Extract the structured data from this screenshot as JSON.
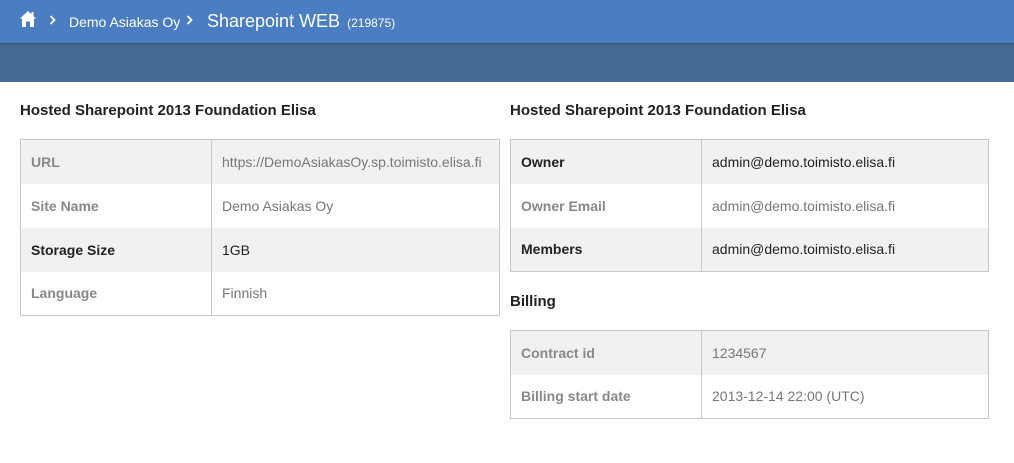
{
  "breadcrumb": {
    "home_icon": "home-icon",
    "customer": "Demo Asiakas Oy",
    "service_name": "Sharepoint WEB",
    "service_id": "(219875)"
  },
  "left_panel": {
    "title": "Hosted Sharepoint 2013 Foundation Elisa",
    "rows": [
      {
        "key": "URL",
        "value": "https://DemoAsiakasOy.sp.toimisto.elisa.fi"
      },
      {
        "key": "Site Name",
        "value": "Demo Asiakas Oy"
      },
      {
        "key": "Storage Size",
        "value": "1GB"
      },
      {
        "key": "Language",
        "value": "Finnish"
      }
    ]
  },
  "right_panel": {
    "title": "Hosted Sharepoint 2013 Foundation Elisa",
    "rows": [
      {
        "key": "Owner",
        "value": "admin@demo.toimisto.elisa.fi"
      },
      {
        "key": "Owner Email",
        "value": "admin@demo.toimisto.elisa.fi"
      },
      {
        "key": "Members",
        "value": "admin@demo.toimisto.elisa.fi"
      }
    ]
  },
  "billing": {
    "title": "Billing",
    "rows": [
      {
        "key": "Contract id",
        "value": "1234567"
      },
      {
        "key": "Billing start date",
        "value": "2013-12-14 22:00 (UTC)"
      }
    ]
  },
  "colors": {
    "topbar": "#4a7dc1",
    "subbar": "#456a95"
  }
}
